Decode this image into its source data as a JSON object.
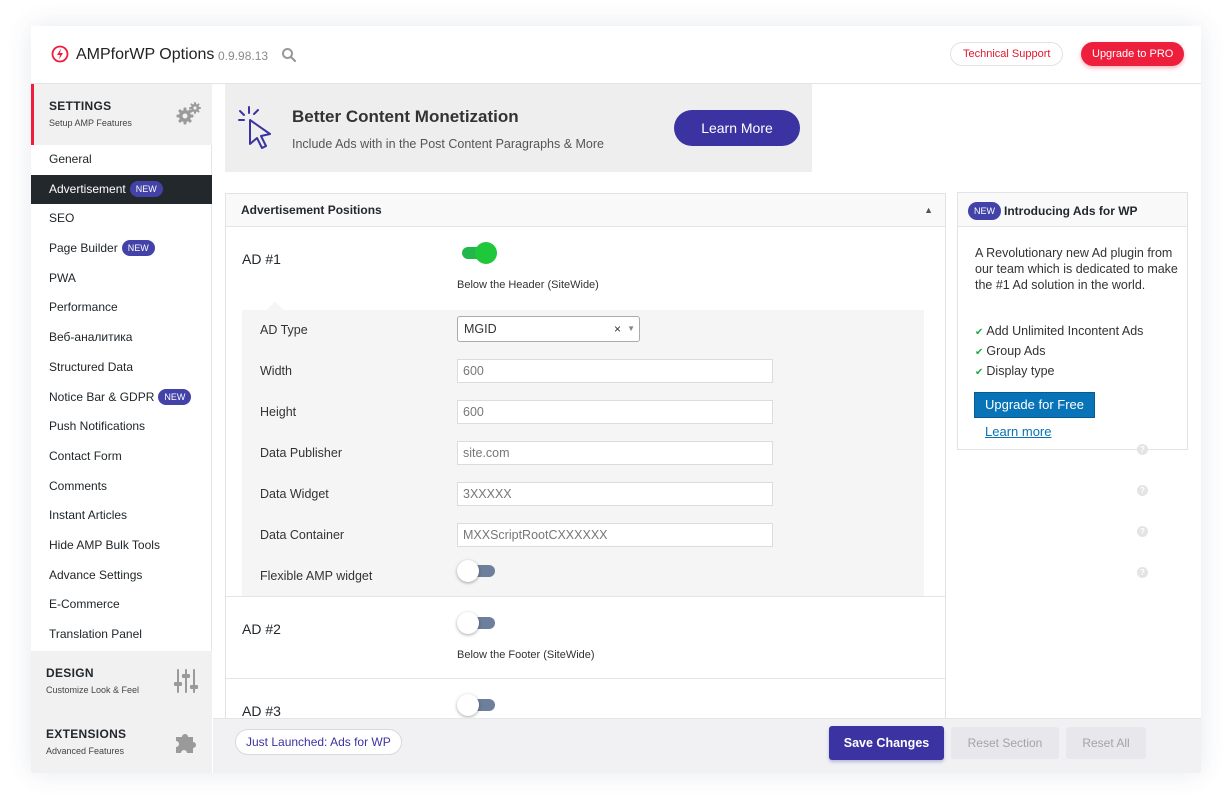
{
  "header": {
    "title": "AMPforWP Options",
    "version": "0.9.98.13",
    "support_label": "Technical Support",
    "upgrade_label": "Upgrade to PRO"
  },
  "sidebar": {
    "settings": {
      "title": "SETTINGS",
      "subtitle": "Setup AMP Features"
    },
    "items": [
      {
        "label": "General",
        "is_new": false,
        "selected": false
      },
      {
        "label": "Advertisement",
        "is_new": true,
        "selected": true
      },
      {
        "label": "SEO",
        "is_new": false,
        "selected": false
      },
      {
        "label": "Page Builder",
        "is_new": true,
        "selected": false
      },
      {
        "label": "PWA",
        "is_new": false,
        "selected": false
      },
      {
        "label": "Performance",
        "is_new": false,
        "selected": false
      },
      {
        "label": "Веб-аналитика",
        "is_new": false,
        "selected": false
      },
      {
        "label": "Structured Data",
        "is_new": false,
        "selected": false
      },
      {
        "label": "Notice Bar & GDPR",
        "is_new": true,
        "selected": false
      },
      {
        "label": "Push Notifications",
        "is_new": false,
        "selected": false
      },
      {
        "label": "Contact Form",
        "is_new": false,
        "selected": false
      },
      {
        "label": "Comments",
        "is_new": false,
        "selected": false
      },
      {
        "label": "Instant Articles",
        "is_new": false,
        "selected": false
      },
      {
        "label": "Hide AMP Bulk Tools",
        "is_new": false,
        "selected": false
      },
      {
        "label": "Advance Settings",
        "is_new": false,
        "selected": false
      },
      {
        "label": "E-Commerce",
        "is_new": false,
        "selected": false
      },
      {
        "label": "Translation Panel",
        "is_new": false,
        "selected": false
      }
    ],
    "new_badge": "NEW",
    "design": {
      "title": "DESIGN",
      "subtitle": "Customize Look & Feel"
    },
    "extensions": {
      "title": "EXTENSIONS",
      "subtitle": "Advanced Features"
    }
  },
  "promo": {
    "heading": "Better Content Monetization",
    "description": "Include Ads with in the Post Content Paragraphs & More",
    "button": "Learn More"
  },
  "panel": {
    "title": "Advertisement Positions",
    "ads": [
      {
        "label": "AD #1",
        "enabled": true,
        "description": "Below the Header (SiteWide)"
      },
      {
        "label": "AD #2",
        "enabled": false,
        "description": "Below the Footer (SiteWide)"
      },
      {
        "label": "AD #3",
        "enabled": false,
        "description": ""
      }
    ],
    "fields": {
      "ad_type": {
        "label": "AD Type",
        "value": "MGID",
        "clear": "×"
      },
      "width": {
        "label": "Width",
        "value": "600"
      },
      "height": {
        "label": "Height",
        "value": "600"
      },
      "publisher": {
        "label": "Data Publisher",
        "value": "site.com"
      },
      "widget": {
        "label": "Data Widget",
        "value": "3XXXXX"
      },
      "container": {
        "label": "Data Container",
        "value": "MXXScriptRootCXXXXXX"
      },
      "flexible": {
        "label": "Flexible AMP widget",
        "enabled": false
      }
    }
  },
  "card": {
    "badge": "NEW",
    "title": "Introducing Ads for WP",
    "paragraph": "A Revolutionary new Ad plugin from our team which is dedicated to make the #1 Ad solution in the world.",
    "features": [
      "Add Unlimited Incontent Ads",
      "Group Ads",
      "Display type"
    ],
    "upgrade_button": "Upgrade for Free",
    "learn_more": "Learn more"
  },
  "footer": {
    "launched": "Just Launched: Ads for WP",
    "save": "Save Changes",
    "reset_section": "Reset Section",
    "reset_all": "Reset All"
  },
  "icons": {
    "logo": "lightning-bolt-icon",
    "search": "search-icon",
    "settings": "gears-icon",
    "design": "sliders-icon",
    "extensions": "puzzle-icon",
    "promo": "cursor-click-icon",
    "help": "question-icon",
    "check": "check-icon"
  },
  "colors": {
    "accent": "#3b33a2",
    "brand_red": "#ee1f3c",
    "toggle_on": "#1ec83a",
    "toggle_off": "#6d7f9b",
    "wp_blue": "#0873b6"
  }
}
